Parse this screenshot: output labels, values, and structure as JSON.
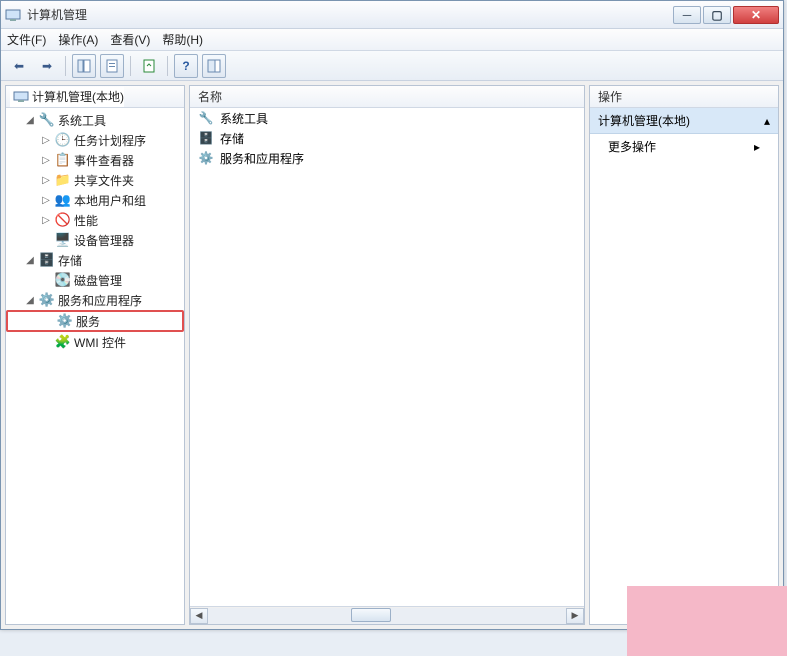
{
  "window": {
    "title": "计算机管理"
  },
  "menus": {
    "file": "文件(F)",
    "action": "操作(A)",
    "view": "查看(V)",
    "help": "帮助(H)"
  },
  "tree": {
    "root": "计算机管理(本地)",
    "sys_tools": "系统工具",
    "task_sched": "任务计划程序",
    "event_viewer": "事件查看器",
    "shared_folders": "共享文件夹",
    "local_users": "本地用户和组",
    "performance": "性能",
    "device_mgr": "设备管理器",
    "storage": "存储",
    "disk_mgmt": "磁盘管理",
    "svc_apps": "服务和应用程序",
    "services": "服务",
    "wmi": "WMI 控件"
  },
  "list": {
    "header": "名称",
    "rows": [
      "系统工具",
      "存储",
      "服务和应用程序"
    ]
  },
  "actions": {
    "header": "操作",
    "subject": "计算机管理(本地)",
    "more": "更多操作"
  }
}
